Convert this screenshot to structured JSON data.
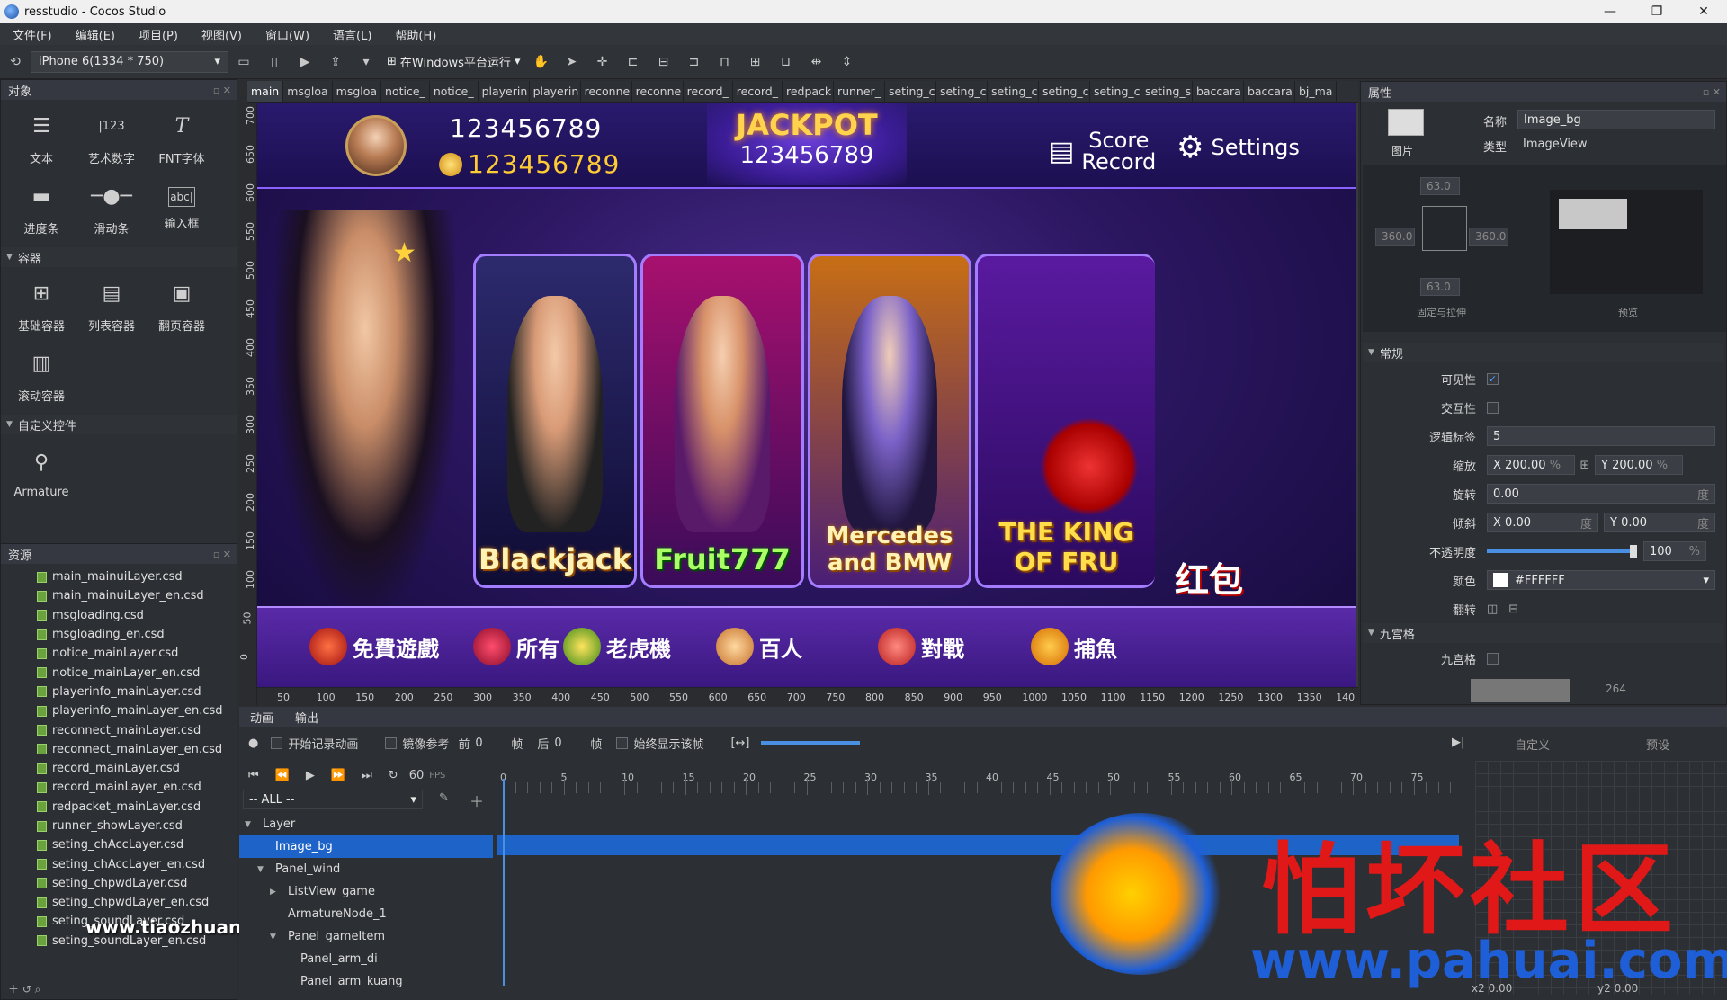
{
  "window": {
    "title": "resstudio - Cocos Studio",
    "buttons": [
      "—",
      "❐",
      "✕"
    ]
  },
  "menu": [
    "文件(F)",
    "编辑(E)",
    "项目(P)",
    "视图(V)",
    "窗口(W)",
    "语言(L)",
    "帮助(H)"
  ],
  "toolbar": {
    "device": "iPhone 6(1334 * 750)",
    "run_label": "在Windows平台运行"
  },
  "objects_panel": {
    "title": "对象",
    "basic": [
      {
        "label": "文本",
        "icon": "text-icon"
      },
      {
        "label": "艺术数字",
        "icon": "art-number-icon"
      },
      {
        "label": "FNT字体",
        "icon": "fnt-font-icon"
      },
      {
        "label": "进度条",
        "icon": "progress-bar-icon"
      },
      {
        "label": "滑动条",
        "icon": "slider-icon"
      },
      {
        "label": "输入框",
        "icon": "input-box-icon"
      }
    ],
    "containers_title": "容器",
    "containers": [
      {
        "label": "基础容器",
        "icon": "panel-icon"
      },
      {
        "label": "列表容器",
        "icon": "list-icon"
      },
      {
        "label": "翻页容器",
        "icon": "pageview-icon"
      },
      {
        "label": "滚动容器",
        "icon": "scrollview-icon"
      }
    ],
    "custom_title": "自定义控件",
    "custom": [
      {
        "label": "Armature",
        "icon": "armature-icon"
      }
    ]
  },
  "resources_panel": {
    "title": "资源",
    "files": [
      "main_mainuiLayer.csd",
      "main_mainuiLayer_en.csd",
      "msgloading.csd",
      "msgloading_en.csd",
      "notice_mainLayer.csd",
      "notice_mainLayer_en.csd",
      "playerinfo_mainLayer.csd",
      "playerinfo_mainLayer_en.csd",
      "reconnect_mainLayer.csd",
      "reconnect_mainLayer_en.csd",
      "record_mainLayer.csd",
      "record_mainLayer_en.csd",
      "redpacket_mainLayer.csd",
      "runner_showLayer.csd",
      "seting_chAccLayer.csd",
      "seting_chAccLayer_en.csd",
      "seting_chpwdLayer.csd",
      "seting_chpwdLayer_en.csd",
      "seting_soundLayer.csd",
      "seting_soundLayer_en.csd"
    ]
  },
  "doc_tabs": [
    "main",
    "msgloa",
    "msgloa",
    "notice_",
    "notice_",
    "playerin",
    "playerin",
    "reconne",
    "reconne",
    "record_",
    "record_",
    "redpack",
    "runner_",
    "seting_c",
    "seting_c",
    "seting_c",
    "seting_c",
    "seting_c",
    "seting_s",
    "baccara",
    "baccara",
    "bj_ma"
  ],
  "ruler": {
    "left": [
      "700",
      "650",
      "600",
      "550",
      "500",
      "450",
      "400",
      "350",
      "300",
      "250",
      "200",
      "150",
      "100",
      "50",
      "0"
    ],
    "bottom": [
      "50",
      "100",
      "150",
      "200",
      "250",
      "300",
      "350",
      "400",
      "450",
      "500",
      "550",
      "600",
      "650",
      "700",
      "750",
      "800",
      "850",
      "900",
      "950",
      "1000",
      "1050",
      "1100",
      "1150",
      "1200",
      "1250",
      "1300",
      "1350",
      "140"
    ]
  },
  "game": {
    "player_id": "123456789",
    "coins": "123456789",
    "jackpot_title": "JACKPOT",
    "jackpot_value": "123456789",
    "score_record": [
      "Score",
      "Record"
    ],
    "settings": "Settings",
    "cards": [
      "Blackjack",
      "Fruit777",
      "Mercedes and BMW",
      "THE KING OF FRU"
    ],
    "bottom": [
      "免費遊戲",
      "所有",
      "老虎機",
      "百人",
      "對戰",
      "捕魚"
    ],
    "hongbao": "红包"
  },
  "properties": {
    "title": "属性",
    "type_label_image": "图片",
    "name_label": "名称",
    "name_value": "Image_bg",
    "type_label": "类型",
    "type_value": "ImageView",
    "layout": {
      "top": "63.0",
      "left": "360.0",
      "right": "360.0",
      "bottom": "63.0",
      "caption": "固定与拉伸",
      "preview": "预览"
    },
    "general_title": "常规",
    "visible_label": "可见性",
    "visible": true,
    "interactive_label": "交互性",
    "interactive": false,
    "tag_label": "逻辑标签",
    "tag_value": "5",
    "scale_label": "缩放",
    "scale_x": "200.00",
    "scale_y": "200.00",
    "rotation_label": "旋转",
    "rotation": "0.00",
    "skew_label": "倾斜",
    "skew_x": "0.00",
    "skew_y": "0.00",
    "opacity_label": "不透明度",
    "opacity": "100",
    "color_label": "颜色",
    "color": "#FFFFFF",
    "flip_label": "翻转",
    "nine_title": "九宫格",
    "nine_label": "九宫格",
    "nine_value": "264",
    "unit_pct": "%",
    "unit_deg": "度",
    "x": "X",
    "y": "Y"
  },
  "timeline": {
    "tabs": [
      "动画",
      "输出"
    ],
    "record_label": "开始记录动画",
    "mirror_label": "镜像参考",
    "before_label": "前",
    "before_value": "0",
    "frame_unit": "帧",
    "after_label": "后",
    "after_value": "0",
    "always_label": "始终显示该帧",
    "fps": "60",
    "fps_label": "FPS",
    "filter": "-- ALL --",
    "custom_tab": "自定义",
    "preset_tab": "预设",
    "frames": [
      "0",
      "5",
      "10",
      "15",
      "20",
      "25",
      "30",
      "35",
      "40",
      "45",
      "50",
      "55",
      "60",
      "65",
      "70",
      "75"
    ],
    "tree": [
      {
        "label": "Layer",
        "indent": 0,
        "arrow": "▼"
      },
      {
        "label": "Image_bg",
        "indent": 1,
        "arrow": "",
        "selected": true
      },
      {
        "label": "Panel_wind",
        "indent": 1,
        "arrow": "▼"
      },
      {
        "label": "ListView_game",
        "indent": 2,
        "arrow": "▶"
      },
      {
        "label": "ArmatureNode_1",
        "indent": 2,
        "arrow": ""
      },
      {
        "label": "Panel_gameItem",
        "indent": 2,
        "arrow": "▼"
      },
      {
        "label": "Panel_arm_di",
        "indent": 3,
        "arrow": ""
      },
      {
        "label": "Panel_arm_kuang",
        "indent": 3,
        "arrow": ""
      }
    ],
    "curve": {
      "x2": "0.00",
      "y2": "0.00"
    }
  },
  "watermark": {
    "site1": "www.tiaozhuan.net",
    "cn": "怕坏社区",
    "site2": "www.pahuai.com"
  }
}
